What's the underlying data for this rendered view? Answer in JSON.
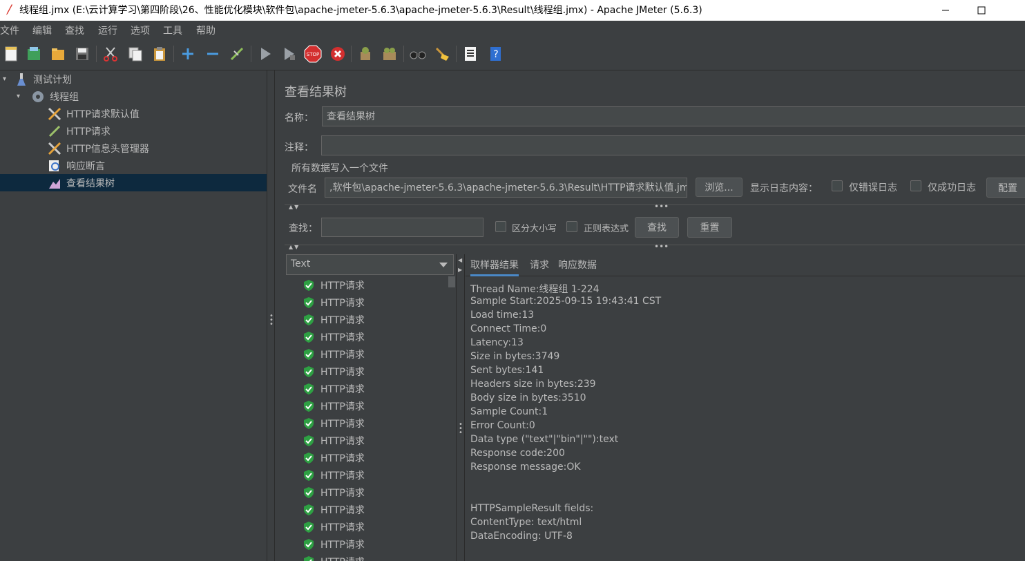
{
  "window": {
    "title": "线程组.jmx (E:\\云计算学习\\第四阶段\\26、性能优化模块\\软件包\\apache-jmeter-5.6.3\\apache-jmeter-5.6.3\\Result\\线程组.jmx) - Apache JMeter (5.6.3)"
  },
  "menu": [
    "文件",
    "编辑",
    "查找",
    "运行",
    "选项",
    "工具",
    "帮助"
  ],
  "toolbar": {
    "icons": [
      "new-icon",
      "templates-icon",
      "open-icon",
      "save-icon",
      "cut-icon",
      "copy-icon",
      "paste-icon",
      "expand-icon",
      "collapse-icon",
      "toggle-icon",
      "start-icon",
      "start-no-pause-icon",
      "stop-icon",
      "shutdown-icon",
      "clear-icon",
      "clear-all-icon",
      "search-icon",
      "reset-search-icon",
      "function-helper-icon",
      "help-icon"
    ]
  },
  "tree": {
    "nodes": [
      {
        "label": "测试计划",
        "icon": "flask-icon"
      },
      {
        "label": "线程组",
        "icon": "gear-icon"
      },
      {
        "label": "HTTP请求默认值",
        "icon": "wrench-icon"
      },
      {
        "label": "HTTP请求",
        "icon": "pipette-icon"
      },
      {
        "label": "HTTP信息头管理器",
        "icon": "wrench-icon"
      },
      {
        "label": "响应断言",
        "icon": "magnifier-icon"
      },
      {
        "label": "查看结果树",
        "icon": "chart-icon"
      }
    ]
  },
  "panel": {
    "title": "查看结果树",
    "name_label": "名称：",
    "name_value": "查看结果树",
    "comment_label": "注释：",
    "comment_value": "",
    "file_section": "所有数据写入一个文件",
    "filename_label": "文件名",
    "filename_value": ",软件包\\apache-jmeter-5.6.3\\apache-jmeter-5.6.3\\Result\\HTTP请求默认值.jmx",
    "browse_label": "浏览...",
    "log_display_label": "显示日志内容：",
    "errors_only_label": "仅错误日志",
    "success_only_label": "仅成功日志",
    "configure_label": "配置",
    "search_label": "查找：",
    "search_value": "",
    "case_sensitive_label": "区分大小写",
    "regex_label": "正则表达式",
    "find_button": "查找",
    "reset_button": "重置"
  },
  "results": {
    "renderer": "Text",
    "items": [
      "HTTP请求",
      "HTTP请求",
      "HTTP请求",
      "HTTP请求",
      "HTTP请求",
      "HTTP请求",
      "HTTP请求",
      "HTTP请求",
      "HTTP请求",
      "HTTP请求",
      "HTTP请求",
      "HTTP请求",
      "HTTP请求",
      "HTTP请求",
      "HTTP请求",
      "HTTP请求",
      "HTTP请求"
    ],
    "tabs": [
      "取样器结果",
      "请求",
      "响应数据"
    ],
    "detail_lines": [
      "Thread Name:线程组 1-224",
      "Sample Start:2025-09-15 19:43:41 CST",
      "Load time:13",
      "Connect Time:0",
      "Latency:13",
      "Size in bytes:3749",
      "Sent bytes:141",
      "Headers size in bytes:239",
      "Body size in bytes:3510",
      "Sample Count:1",
      "Error Count:0",
      "Data type (\"text\"|\"bin\"|\"\"):text",
      "Response code:200",
      "Response message:OK",
      "",
      "",
      "HTTPSampleResult fields:",
      "ContentType: text/html",
      "DataEncoding: UTF-8"
    ]
  }
}
